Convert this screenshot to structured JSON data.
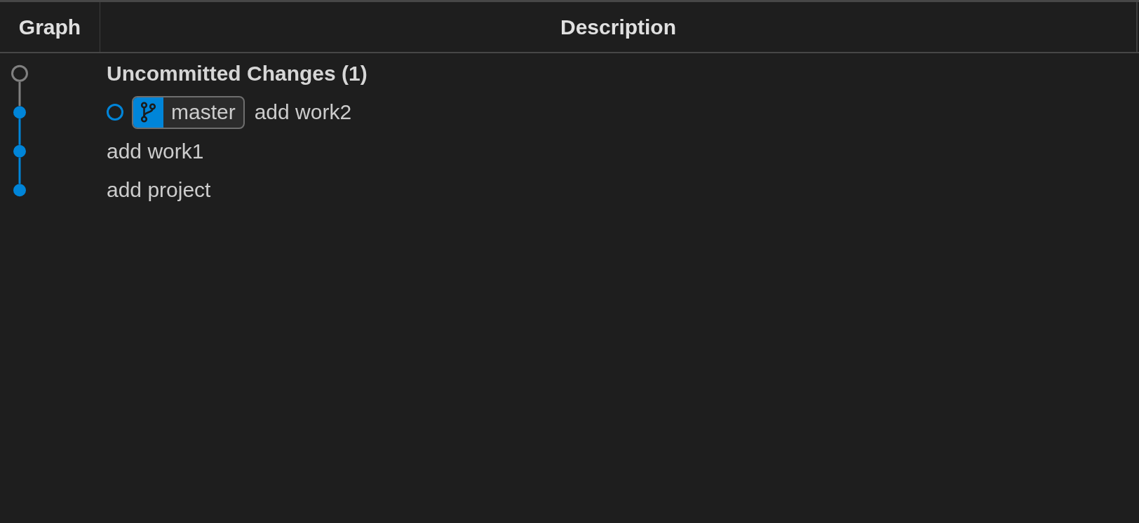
{
  "columns": [
    {
      "label": "Graph"
    },
    {
      "label": "Description"
    }
  ],
  "rows": [
    {
      "kind": "uncommitted",
      "color": "#808080",
      "head": false,
      "description": "Uncommitted Changes (1)"
    },
    {
      "kind": "commit",
      "color": "#0085d9",
      "head": true,
      "branches": [
        {
          "name": "master"
        }
      ],
      "description": "add work2"
    },
    {
      "kind": "commit",
      "color": "#0085d9",
      "head": false,
      "description": "add work1"
    },
    {
      "kind": "commit",
      "color": "#0085d9",
      "head": false,
      "description": "add project"
    }
  ]
}
